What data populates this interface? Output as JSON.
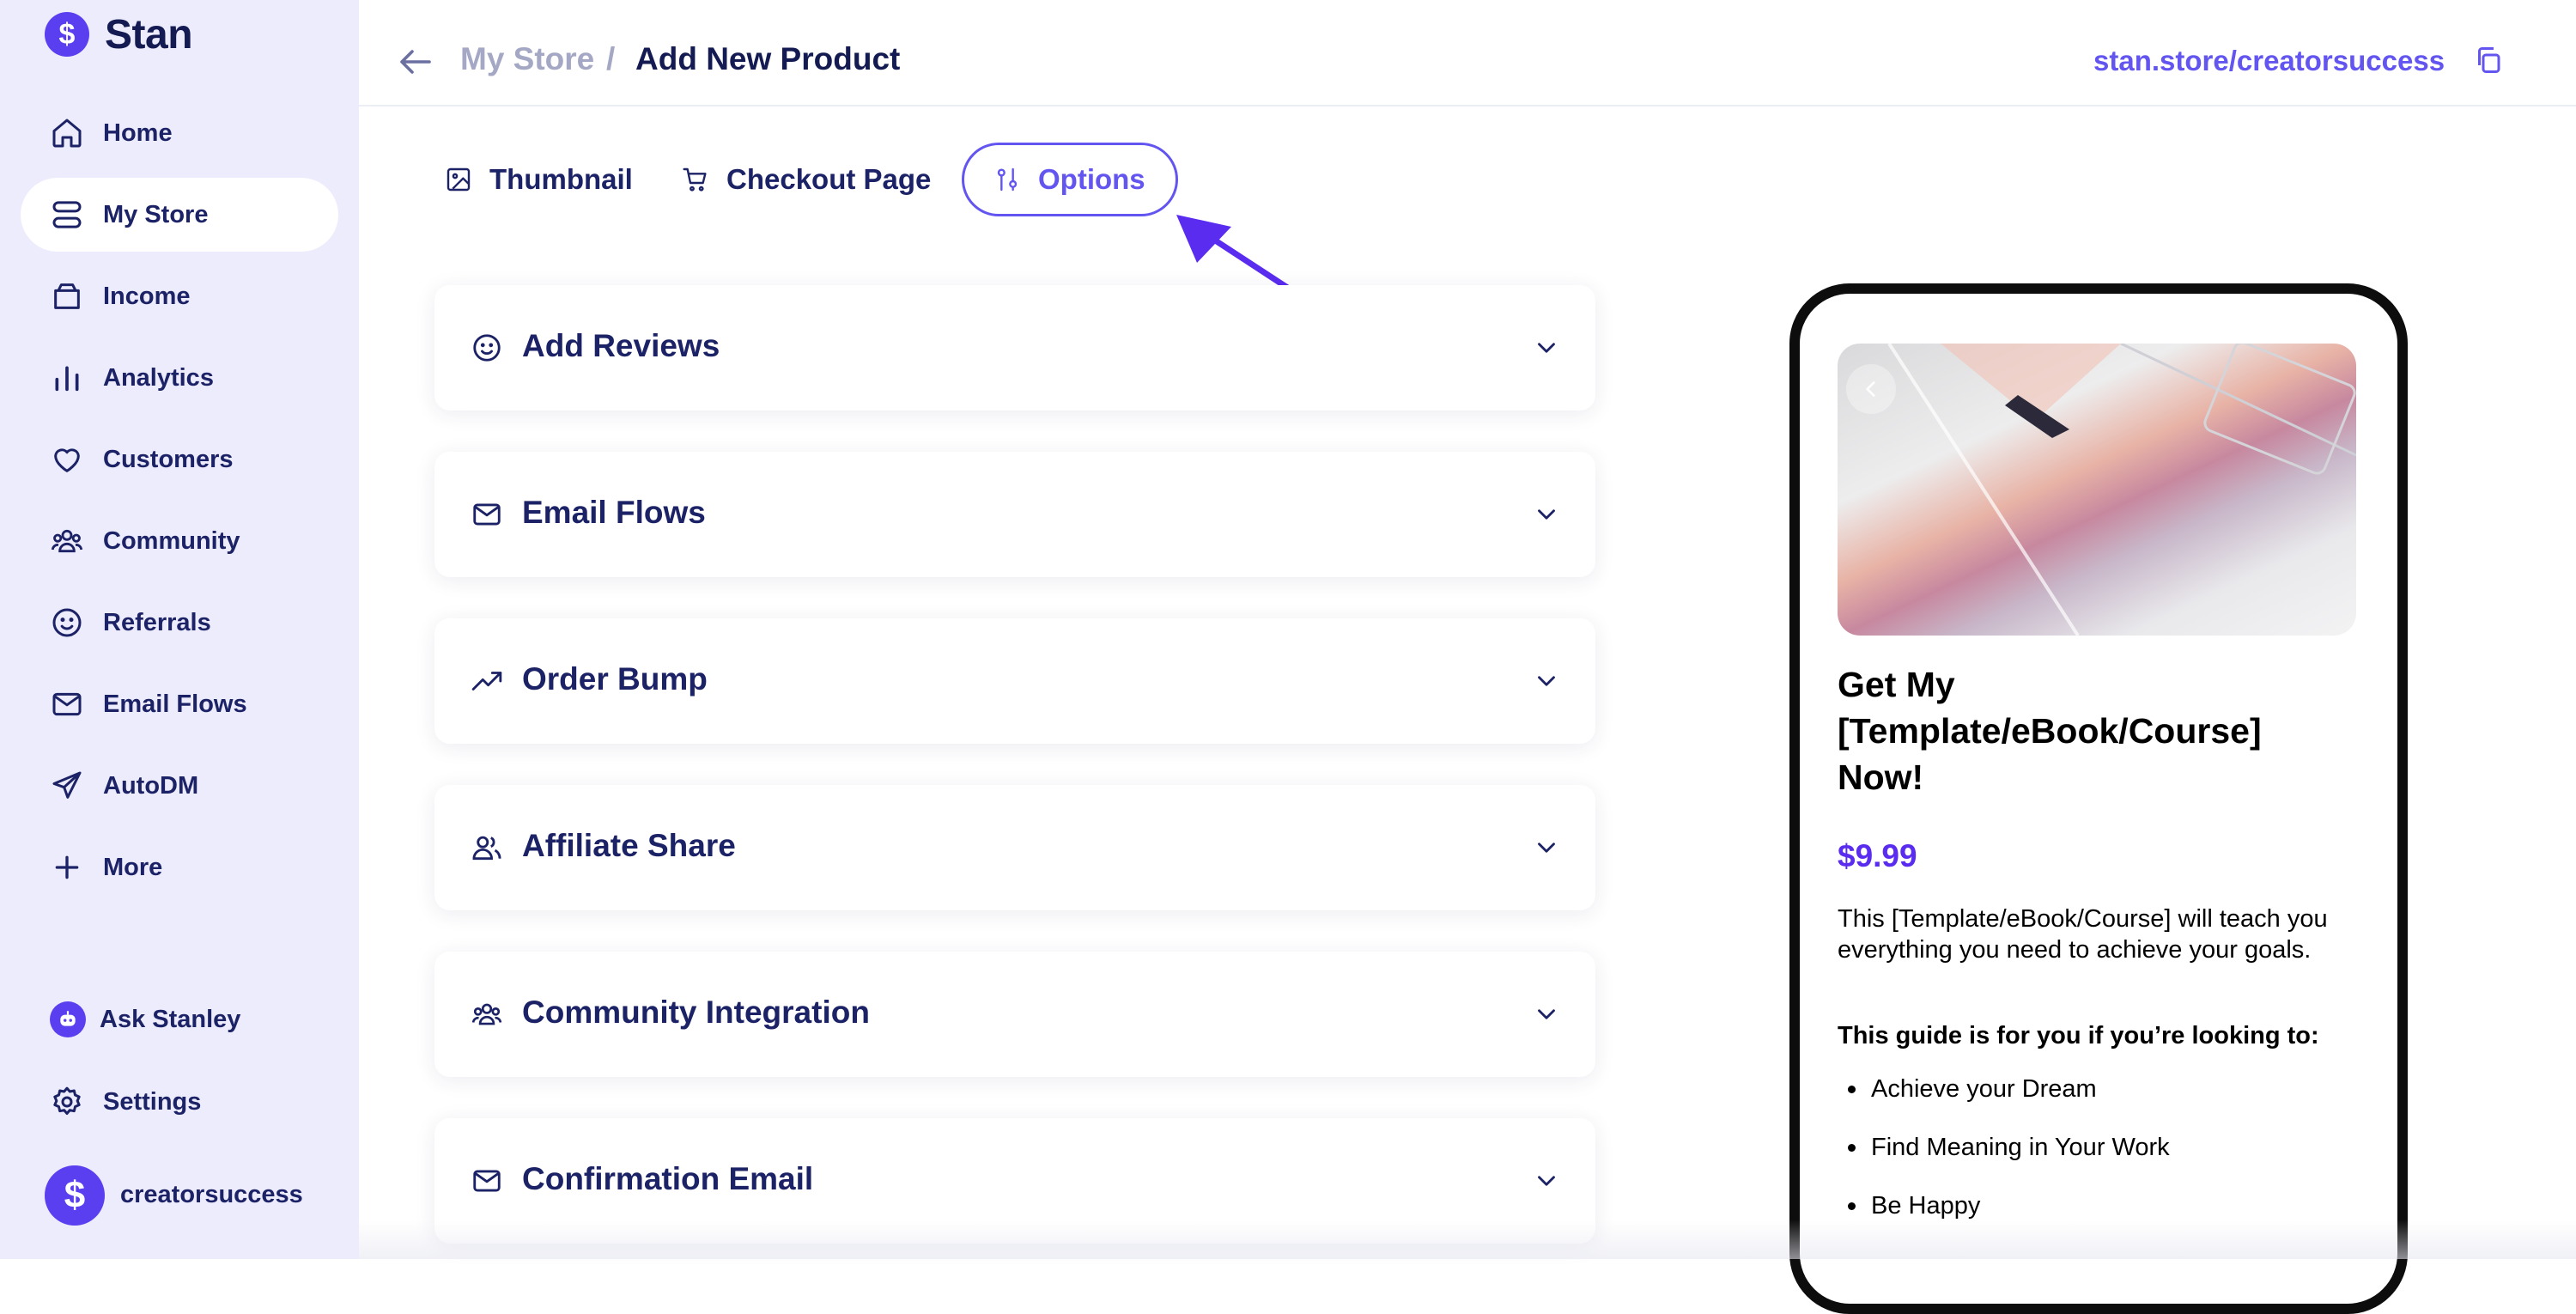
{
  "brand": {
    "name": "Stan",
    "logo_glyph": "$"
  },
  "sidebar": {
    "items": [
      {
        "label": "Home",
        "icon": "home-icon"
      },
      {
        "label": "My Store",
        "icon": "store-icon",
        "active": true
      },
      {
        "label": "Income",
        "icon": "wallet-icon"
      },
      {
        "label": "Analytics",
        "icon": "bar-chart-icon"
      },
      {
        "label": "Customers",
        "icon": "heart-icon"
      },
      {
        "label": "Community",
        "icon": "users-icon"
      },
      {
        "label": "Referrals",
        "icon": "smiley-icon"
      },
      {
        "label": "Email Flows",
        "icon": "mail-icon"
      },
      {
        "label": "AutoDM",
        "icon": "send-icon"
      },
      {
        "label": "More",
        "icon": "plus-icon"
      }
    ],
    "ask_stanley": "Ask Stanley",
    "settings": "Settings",
    "profile": {
      "name": "creatorsuccess",
      "avatar_glyph": "$"
    }
  },
  "header": {
    "breadcrumb_parent": "My Store",
    "breadcrumb_sep": "/",
    "breadcrumb_current": "Add New Product",
    "store_url": "stan.store/creatorsuccess"
  },
  "tabs": [
    {
      "label": "Thumbnail",
      "icon": "image-icon"
    },
    {
      "label": "Checkout Page",
      "icon": "cart-icon"
    },
    {
      "label": "Options",
      "icon": "sliders-icon",
      "active": true
    }
  ],
  "options": [
    {
      "title": "Add Reviews",
      "icon": "smiley-icon"
    },
    {
      "title": "Email Flows",
      "icon": "mail-icon"
    },
    {
      "title": "Order Bump",
      "icon": "trending-up-icon"
    },
    {
      "title": "Affiliate Share",
      "icon": "users-icon"
    },
    {
      "title": "Community Integration",
      "icon": "community-icon"
    },
    {
      "title": "Confirmation Email",
      "icon": "mail-icon"
    }
  ],
  "preview": {
    "title": "Get My [Template/eBook/Course] Now!",
    "price": "$9.99",
    "description": "This [Template/eBook/Course] will teach you everything you need to achieve your goals.",
    "subheading": "This guide is for you if you’re looking to:",
    "bullets": [
      "Achieve your Dream",
      "Find Meaning in Your Work",
      "Be Happy"
    ]
  },
  "colors": {
    "accent": "#6355ef",
    "brand": "#5a3ff0",
    "sidebar_bg": "#edecfd",
    "text_dark": "#141a52",
    "price": "#5a2cf0"
  }
}
